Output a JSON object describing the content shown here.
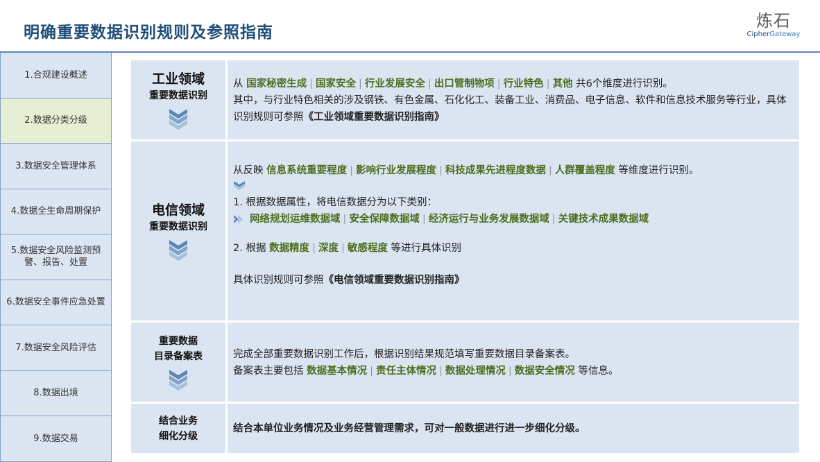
{
  "header": {
    "title": "明确重要数据识别规则及参照指南",
    "logo_cn": "炼石",
    "logo_en_a": "Cipher",
    "logo_en_b": "Gateway"
  },
  "sidebar": {
    "items": [
      {
        "label": "1.合规建设概述",
        "active": false
      },
      {
        "label": "2.数据分类分级",
        "active": true
      },
      {
        "label": "3.数据安全管理体系",
        "active": false
      },
      {
        "label": "4.数据全生命周期保护",
        "active": false
      },
      {
        "label": "5.数据安全风险监测预警、报告、处置",
        "active": false
      },
      {
        "label": "6.数据安全事件应急处置",
        "active": false
      },
      {
        "label": "7.数据安全风险评估",
        "active": false
      },
      {
        "label": "8.数据出境",
        "active": false
      },
      {
        "label": "9.数据交易",
        "active": false
      }
    ]
  },
  "industry": {
    "label_main": "工业领域",
    "label_sub": "重要数据识别",
    "prefix": "从",
    "dims": [
      "国家秘密生成",
      "国家安全",
      "行业发展安全",
      "出口管制物项",
      "行业特色",
      "其他"
    ],
    "suffix": "共6个维度进行识别。",
    "line2": "其中，与行业特色相关的涉及钢铁、有色金属、石化化工、装备工业、消费品、电子信息、软件和信息技术服务等行业，具体识别规则可参照",
    "guide": "《工业领域重要数据识别指南》"
  },
  "telecom": {
    "label_main": "电信领域",
    "label_sub": "重要数据识别",
    "prefix": "从反映",
    "dims": [
      "信息系统重要程度",
      "影响行业发展程度",
      "科技成果先进程度数据",
      "人群覆盖程度"
    ],
    "suffix": "等维度进行识别。",
    "step1": "1. 根据数据属性，将电信数据分为以下类别：",
    "domains": [
      "网络规划运维数据域",
      "安全保障数据域",
      "经济运行与业务发展数据域",
      "关键技术成果数据域"
    ],
    "step2_prefix": "2. 根据",
    "step2_dims": [
      "数据精度",
      "深度",
      "敏感程度"
    ],
    "step2_suffix": "等进行具体识别",
    "ref_prefix": "具体识别规则可参照",
    "guide": "《电信领域重要数据识别指南》"
  },
  "catalog": {
    "label_line1": "重要数据",
    "label_line2": "目录备案表",
    "line1": "完成全部重要数据识别工作后，根据识别结果规范填写重要数据目录备案表。",
    "line2_prefix": "备案表主要包括",
    "items": [
      "数据基本情况",
      "责任主体情况",
      "数据处理情况",
      "数据安全情况"
    ],
    "line2_suffix": "等信息。"
  },
  "refine": {
    "label_line1": "结合业务",
    "label_line2": "细化分级",
    "text": "结合本单位业务情况及业务经营管理需求，可对一般数据进行进一步细化分级。"
  },
  "colors": {
    "title": "#1f4e79",
    "panel_bg": "#dbe5f1",
    "highlight": "#4f6d1f",
    "sidebar_active": "#e6eed3",
    "chevron": "#5b86b6"
  }
}
